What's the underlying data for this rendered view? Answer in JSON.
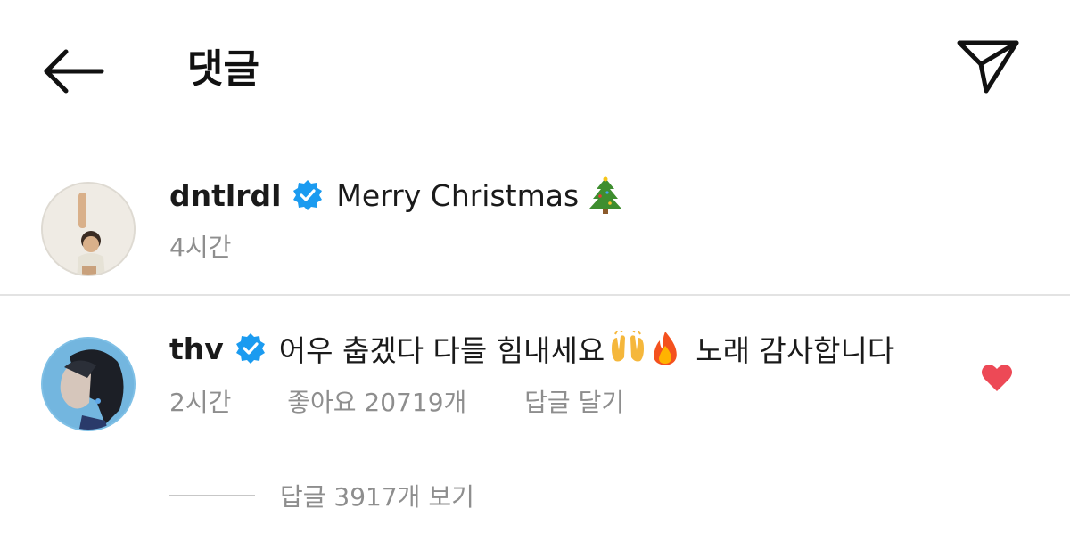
{
  "header": {
    "title": "댓글"
  },
  "comments": [
    {
      "username": "dntlrdl",
      "verified": true,
      "text": "Merry Christmas",
      "emoji": "christmas-tree-icon",
      "time": "4시간"
    },
    {
      "username": "thv",
      "verified": true,
      "text_before": "어우 춥겠다 다들 힘내세요",
      "emojis": [
        "raising-hands-icon",
        "fire-icon"
      ],
      "text_after": "노래 감사합니다",
      "time": "2시간",
      "likes": "좋아요 20719개",
      "reply_action": "답글 달기",
      "liked": true
    }
  ],
  "replies": {
    "label": "답글 3917개 보기"
  },
  "colors": {
    "verified_blue": "#1b9bf0",
    "heart_red": "#ed4956",
    "muted_text": "#8e8e8e"
  }
}
